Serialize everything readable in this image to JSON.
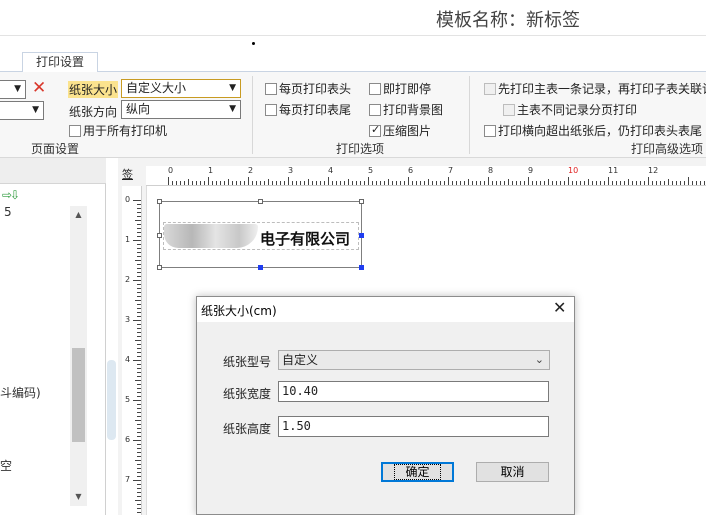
{
  "window": {
    "title": "模板名称：新标签"
  },
  "tabs": [
    {
      "label": "打印设置"
    }
  ],
  "ribbon": {
    "page_setup": {
      "paper_size_label": "纸张大小",
      "paper_size_value": "自定义大小",
      "orientation_label": "纸张方向",
      "orientation_value": "纵向",
      "all_printers": "用于所有打印机",
      "group_label": "页面设置"
    },
    "print_options": {
      "header_each_page": "每页打印表头",
      "footer_each_page": "每页打印表尾",
      "print_and_stop": "即打即停",
      "print_background": "打印背景图",
      "compress_images": "压缩图片",
      "group_label": "打印选项"
    },
    "advanced": {
      "print_main_first": "先打印主表一条记录，再打印子表关联记",
      "main_no_page_break": "主表不同记录分页打印",
      "print_header_overflow": "打印横向超出纸张后，仍打印表头表尾",
      "group_label": "打印高级选项"
    }
  },
  "left_panel": {
    "items": [
      {
        "text": "5"
      },
      {
        "text": "斗编码)"
      },
      {
        "text": "空"
      }
    ]
  },
  "ruler": {
    "corner": "签",
    "h_labels": [
      "0",
      "1",
      "2",
      "3",
      "4",
      "5",
      "6",
      "7",
      "8",
      "9",
      "10",
      "11",
      "12"
    ],
    "v_labels": [
      "0",
      "1",
      "2",
      "3",
      "4",
      "5",
      "6",
      "7"
    ],
    "highlight_color": "#e02020"
  },
  "label": {
    "text": "电子有限公司"
  },
  "dialog": {
    "title": "纸张大小(cm)",
    "type_label": "纸张型号",
    "type_value": "自定义",
    "width_label": "纸张宽度",
    "width_value": "10.40",
    "height_label": "纸张高度",
    "height_value": "1.50",
    "ok_label": "确定",
    "cancel_label": "取消"
  }
}
